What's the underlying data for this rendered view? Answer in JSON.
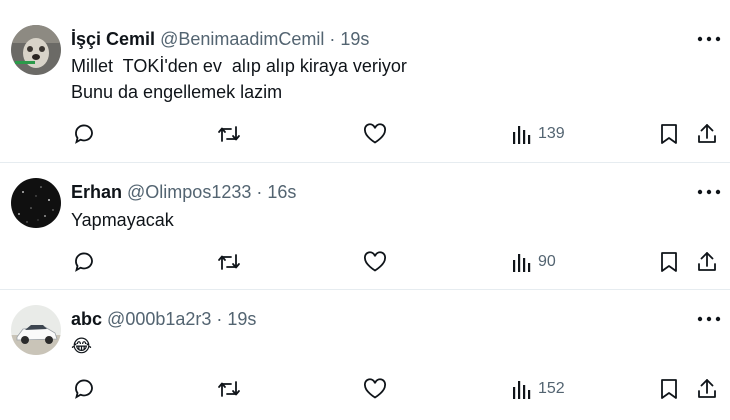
{
  "tweets": [
    {
      "name": "İşçi Cemil",
      "handle": "@BenimaadimCemil",
      "time": "19s",
      "lines": [
        "Millet  TOKİ'den ev  alıp alıp kiraya veriyor",
        "Bunu da engellemek lazim"
      ],
      "views": "139",
      "avatar": "dog-photo-avatar"
    },
    {
      "name": "Erhan",
      "handle": "@Olimpos1233",
      "time": "16s",
      "lines": [
        "Yapmayacak"
      ],
      "views": "90",
      "avatar": "starry-dark-avatar"
    },
    {
      "name": "abc",
      "handle": "@000b1a2r3",
      "time": "19s",
      "lines": [
        "😂"
      ],
      "views": "152",
      "avatar": "white-car-avatar"
    }
  ],
  "separator": " · ",
  "icons": [
    "reply-icon",
    "retweet-icon",
    "like-icon",
    "views-icon",
    "bookmark-icon",
    "share-icon",
    "more-icon"
  ],
  "colors": {
    "text": "#0f1419",
    "secondary": "#536471",
    "divider": "#e6ecf0"
  }
}
